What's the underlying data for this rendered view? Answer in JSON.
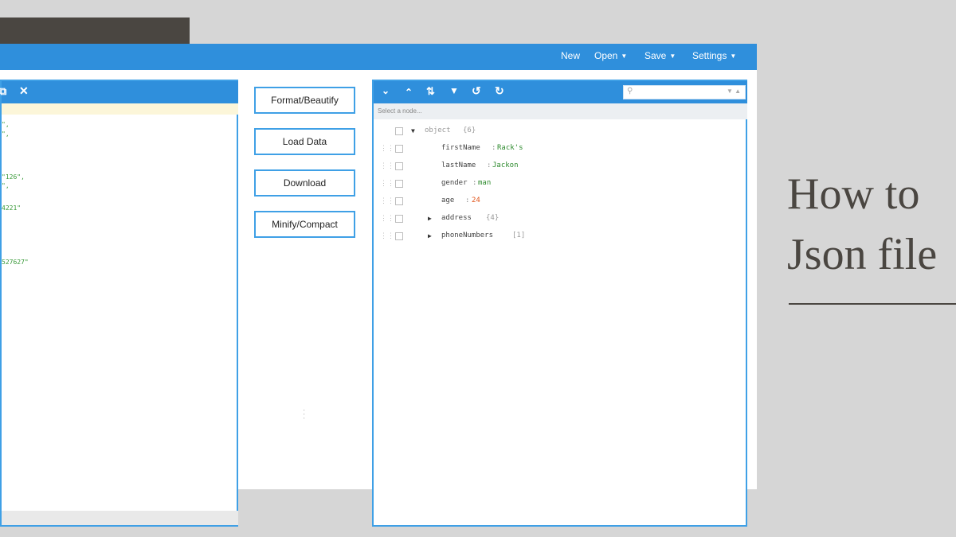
{
  "menu": {
    "new": "New",
    "open": "Open",
    "save": "Save",
    "settings": "Settings"
  },
  "left_editor": {
    "code_fragments": [
      "\",",
      "\",",
      "\"126\",",
      "\",",
      "4221\"",
      "527627\""
    ]
  },
  "actions": {
    "format": "Format/Beautify",
    "load": "Load Data",
    "download": "Download",
    "minify": "Minify/Compact"
  },
  "tree": {
    "breadcrumb_placeholder": "Select a node...",
    "root": {
      "key": "object",
      "count": "{6}"
    },
    "fields": [
      {
        "key": "firstName",
        "value": "Rack's",
        "kind": "string"
      },
      {
        "key": "lastName",
        "value": "Jackon",
        "kind": "string"
      },
      {
        "key": "gender",
        "value": "man",
        "kind": "string"
      },
      {
        "key": "age",
        "value": "24",
        "kind": "number"
      }
    ],
    "objects": [
      {
        "key": "address",
        "count": "{4}"
      },
      {
        "key": "phoneNumbers",
        "count": "[1]"
      }
    ]
  },
  "article_title": {
    "line1": "How to",
    "line2": "Json file"
  },
  "colors": {
    "accent": "#2f8fdc",
    "string": "#2e8b2e",
    "number": "#e0541a",
    "banner_dark": "#4a4641",
    "background": "#d6d6d6"
  }
}
